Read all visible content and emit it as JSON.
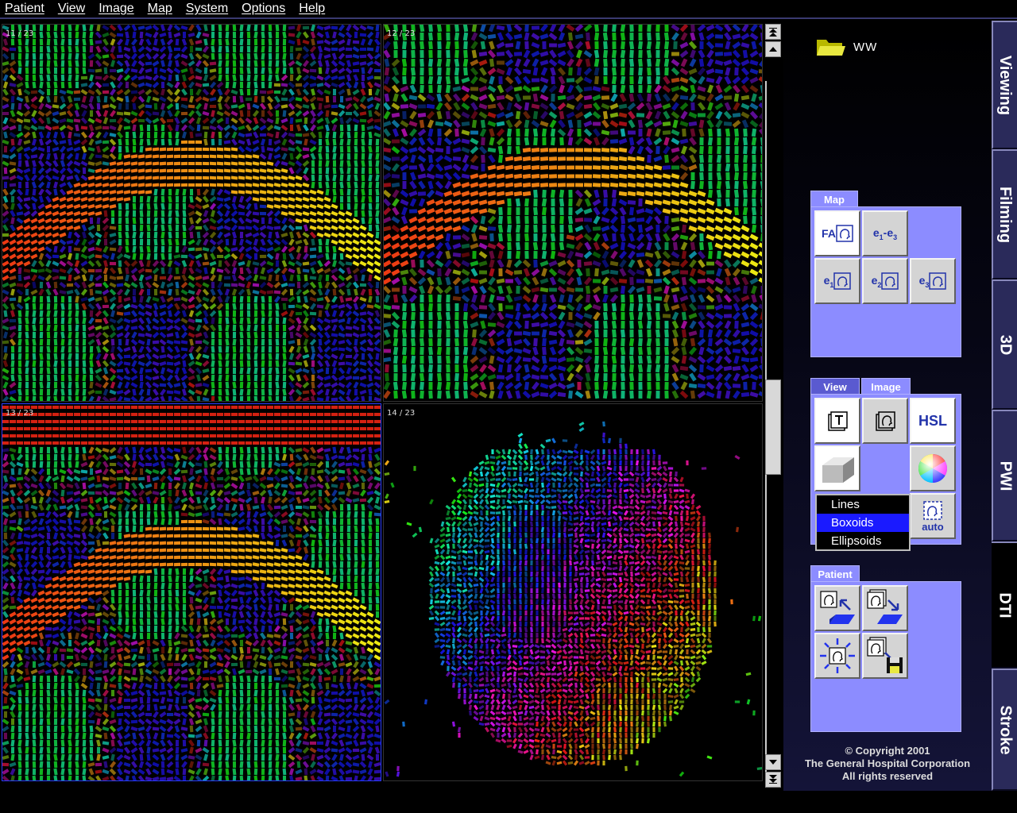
{
  "menu": {
    "items": [
      "Patient",
      "View",
      "Image",
      "Map",
      "System",
      "Options",
      "Help"
    ]
  },
  "viewer": {
    "viewports": [
      {
        "label": "11 / 23",
        "active": false
      },
      {
        "label": "12 / 23",
        "active": false
      },
      {
        "label": "13 / 23",
        "active": true
      },
      {
        "label": "14 / 23",
        "active": false
      }
    ]
  },
  "scrollbar": {
    "top_icon": "scroll-top-icon",
    "up_icon": "scroll-up-icon",
    "down_icon": "scroll-down-icon",
    "bottom_icon": "scroll-bottom-icon"
  },
  "panel": {
    "folder": {
      "name": "WW",
      "icon": "folder-icon"
    },
    "map_group": {
      "tab": "Map",
      "buttons": [
        {
          "label": "FA",
          "icon": "head-icon"
        },
        {
          "label": "e1-e3",
          "icon": ""
        },
        {
          "label": "e1",
          "icon": "head-icon"
        },
        {
          "label": "e2",
          "icon": "head-icon"
        },
        {
          "label": "e3",
          "icon": "head-icon"
        }
      ]
    },
    "view_group": {
      "tabs": [
        "View",
        "Image"
      ],
      "buttons": [
        {
          "label": "",
          "icon": "text-overlay-icon"
        },
        {
          "label": "",
          "icon": "head-icon"
        },
        {
          "label": "HSL",
          "icon": ""
        },
        {
          "label": "",
          "icon": "boxoid-icon"
        },
        {
          "label": "",
          "icon": "color-sphere-icon"
        },
        {
          "label": "auto",
          "icon": "auto-head-icon"
        }
      ],
      "dropdown": {
        "options": [
          "Lines",
          "Boxoids",
          "Ellipsoids"
        ],
        "selected": "Boxoids"
      }
    },
    "patient_group": {
      "tab": "Patient",
      "buttons": [
        {
          "icon": "load-patient-icon"
        },
        {
          "icon": "export-patient-icon"
        },
        {
          "icon": "highlight-patient-icon"
        },
        {
          "icon": "save-patient-icon"
        }
      ]
    },
    "copyright": {
      "line1": "© Copyright 2001",
      "line2": "The General Hospital Corporation",
      "line3": "All rights reserved"
    }
  },
  "sidetabs": [
    {
      "label": "Viewing",
      "active": false
    },
    {
      "label": "Filming",
      "active": false
    },
    {
      "label": "3D",
      "active": false
    },
    {
      "label": "PWI",
      "active": false
    },
    {
      "label": "DTI",
      "active": true
    },
    {
      "label": "Stroke",
      "active": false
    }
  ],
  "colors": {
    "accent": "#8c8cff",
    "active_border": "#2a3cff",
    "selected_option": "#1a1aff"
  }
}
